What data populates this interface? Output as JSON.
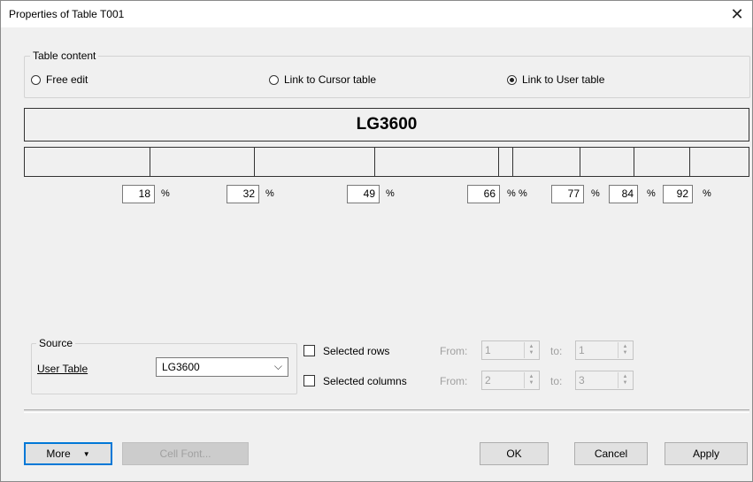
{
  "window": {
    "title": "Properties of Table T001",
    "close_glyph": "✕"
  },
  "table_content": {
    "group_label": "Table content",
    "radios": [
      {
        "label": "Free edit",
        "selected": false
      },
      {
        "label": "Link to Cursor table",
        "selected": false
      },
      {
        "label": "Link to User table",
        "selected": true
      }
    ]
  },
  "preview": {
    "title": "LG3600",
    "columns": [
      {
        "pct": "18",
        "pct_label": "%"
      },
      {
        "pct": "32",
        "pct_label": "%"
      },
      {
        "pct": "49",
        "pct_label": "%"
      },
      {
        "pct": "66",
        "pct_label": "%"
      },
      {
        "pct": "",
        "pct_label": "%"
      },
      {
        "pct": "77",
        "pct_label": "%"
      },
      {
        "pct": "84",
        "pct_label": "%"
      },
      {
        "pct": "92",
        "pct_label": "%"
      }
    ]
  },
  "source": {
    "group_label": "Source",
    "user_table_label": "User Table",
    "user_table_value": "LG3600",
    "dropdown_glyph": "⌵"
  },
  "selection": {
    "rows_label": "Selected rows",
    "columns_label": "Selected columns",
    "from_label": "From:",
    "to_label": "to:",
    "rows_from": "1",
    "rows_to": "1",
    "cols_from": "2",
    "cols_to": "3"
  },
  "buttons": {
    "more": "More",
    "more_arrow": "▼",
    "cell_font": "Cell Font...",
    "ok": "OK",
    "cancel": "Cancel",
    "apply": "Apply"
  },
  "colors": {
    "focus_border": "#0078d7",
    "window_bg": "#f0f0f0"
  }
}
